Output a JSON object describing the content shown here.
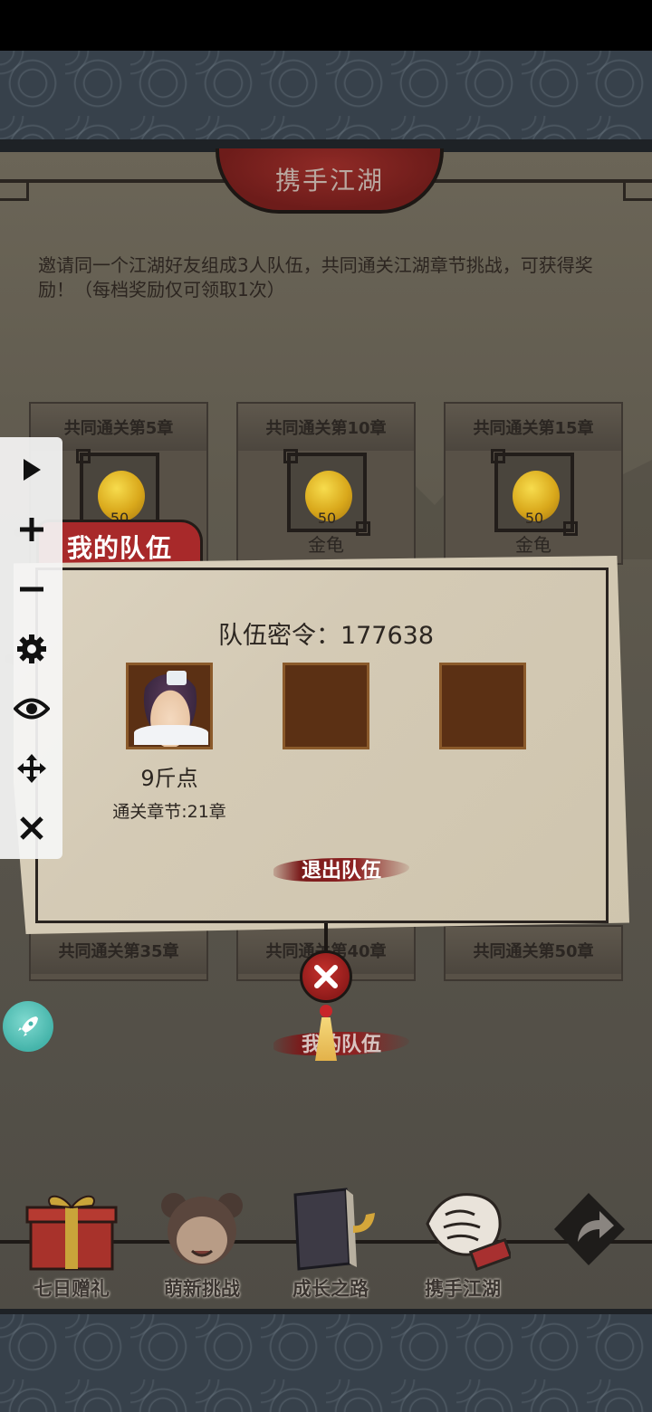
{
  "page": {
    "title": "携手江湖"
  },
  "intro": "邀请同一个江湖好友组成3人队伍，共同通关江湖章节挑战，可获得奖励！（每档奖励仅可领取1次）",
  "rewards_top": [
    {
      "header": "共同通关第5章",
      "count": "50",
      "name": ""
    },
    {
      "header": "共同通关第10章",
      "count": "50",
      "name": "金龟"
    },
    {
      "header": "共同通关第15章",
      "count": "50",
      "name": "金龟"
    }
  ],
  "rewards_bottom": [
    {
      "header": "共同通关第35章"
    },
    {
      "header": "共同通关第40章"
    },
    {
      "header": "共同通关第50章"
    }
  ],
  "team_modal": {
    "tab_label": "我的队伍",
    "code_text": "队伍密令：177638",
    "member": {
      "name": "9斤点",
      "chapter": "通关章节:21章"
    },
    "leave_button": "退出队伍"
  },
  "background_button": "我的队伍",
  "side_toolbar": [
    "play-icon",
    "zoom-in-icon",
    "zoom-out-icon",
    "settings-icon",
    "eye-icon",
    "move-icon",
    "close-icon"
  ],
  "bottom_nav": [
    {
      "label": "七日赠礼",
      "icon": "gift-box-icon"
    },
    {
      "label": "萌新挑战",
      "icon": "girl-avatar-icon"
    },
    {
      "label": "成长之路",
      "icon": "book-icon"
    },
    {
      "label": "携手江湖",
      "icon": "handshake-icon"
    },
    {
      "label": "",
      "icon": "share-arrow-icon"
    }
  ],
  "colors": {
    "accent_red": "#a8292a",
    "parchment": "#d8cfbb",
    "panel": "#5f5a4e"
  }
}
